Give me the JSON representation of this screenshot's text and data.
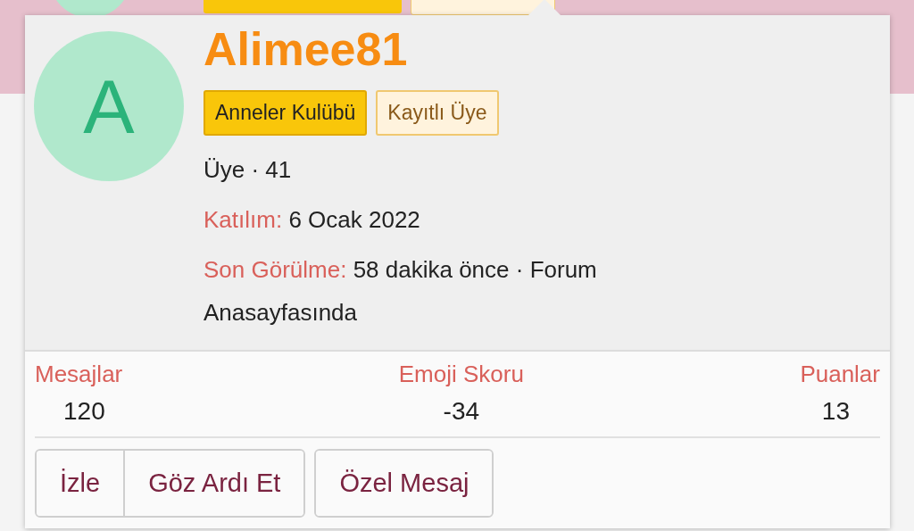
{
  "profile": {
    "avatar_letter": "A",
    "username": "Alimee81",
    "badges": [
      {
        "label": "Anneler Kulübü",
        "kind": "primary"
      },
      {
        "label": "Kayıtlı Üye",
        "kind": "secondary"
      }
    ],
    "title_line": "Üye · 41",
    "details": [
      {
        "label": "Katılım:",
        "value": "6 Ocak 2022"
      },
      {
        "label": "Son Görülme:",
        "value": "58 dakika önce · Forum Anasayfasında"
      }
    ]
  },
  "stats": [
    {
      "label": "Mesajlar",
      "value": "120"
    },
    {
      "label": "Emoji Skoru",
      "value": "-34"
    },
    {
      "label": "Puanlar",
      "value": "13"
    }
  ],
  "button_groups": [
    [
      "İzle",
      "Göz Ardı Et"
    ],
    [
      "Özel Mesaj"
    ]
  ]
}
